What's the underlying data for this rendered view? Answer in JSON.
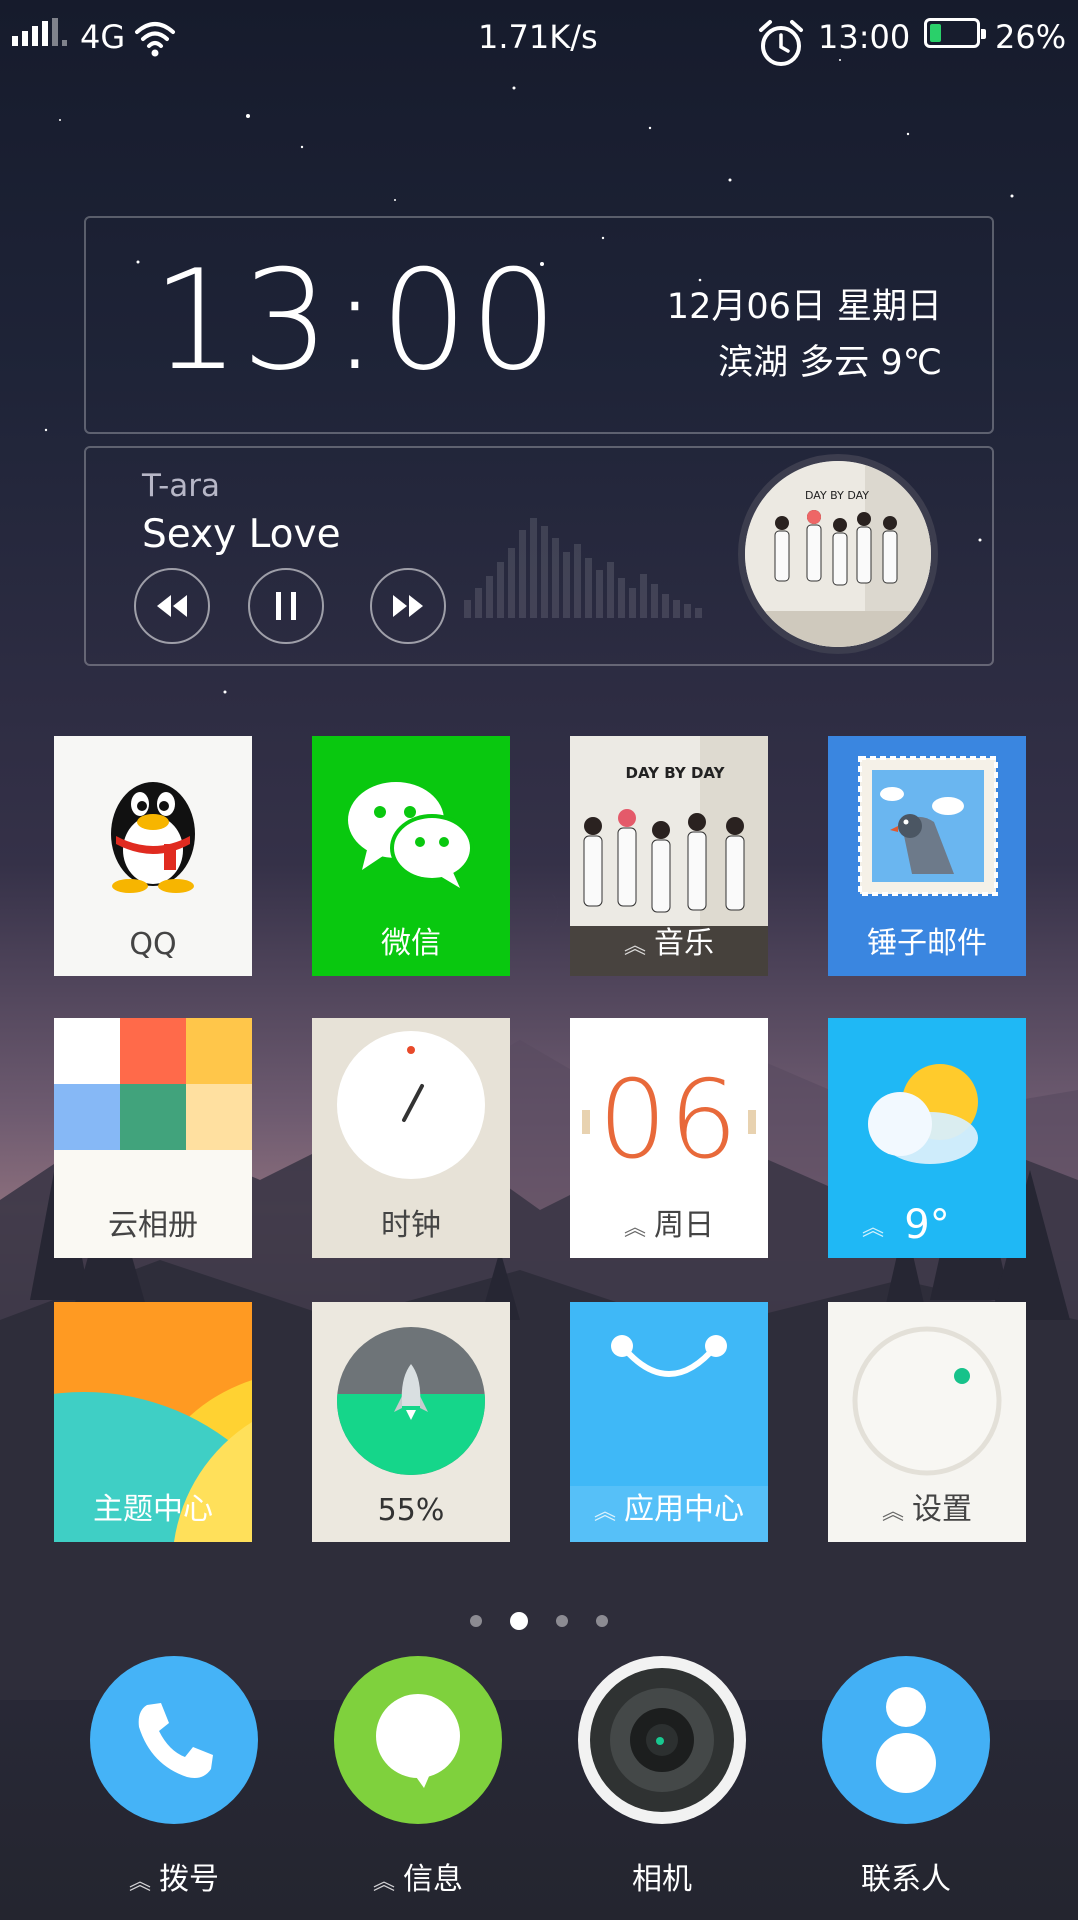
{
  "status_bar": {
    "network": "4G",
    "speed": "1.71K/s",
    "time": "13:00",
    "battery": "26%",
    "battery_level": 0.26
  },
  "clock_widget": {
    "time": "13:00",
    "date": "12月06日  星期日",
    "weather": "滨湖  多云  9℃"
  },
  "music_widget": {
    "artist": "T-ara",
    "song": "Sexy Love",
    "album_text": "DAY BY DAY"
  },
  "apps": [
    {
      "label": "QQ"
    },
    {
      "label": "微信"
    },
    {
      "label": "音乐"
    },
    {
      "label": "锤子邮件"
    },
    {
      "label": "云相册"
    },
    {
      "label": "时钟"
    },
    {
      "label": "周日",
      "date_number": "06"
    },
    {
      "label": "9°"
    },
    {
      "label": "主题中心"
    },
    {
      "label": "55%",
      "level": 0.55
    },
    {
      "label": "应用中心"
    },
    {
      "label": "设置"
    }
  ],
  "pager": {
    "count": 4,
    "active": 2
  },
  "dock": [
    {
      "label": "拨号"
    },
    {
      "label": "信息"
    },
    {
      "label": "相机"
    },
    {
      "label": "联系人"
    }
  ],
  "colors": {
    "wechat": "#09c80f",
    "mail": "#3a86e0",
    "weather": "#1fb8f5",
    "appcenter": "#3fb8f7",
    "phone": "#45b3f7",
    "messages": "#7fd13d",
    "contacts": "#43b0f5"
  }
}
